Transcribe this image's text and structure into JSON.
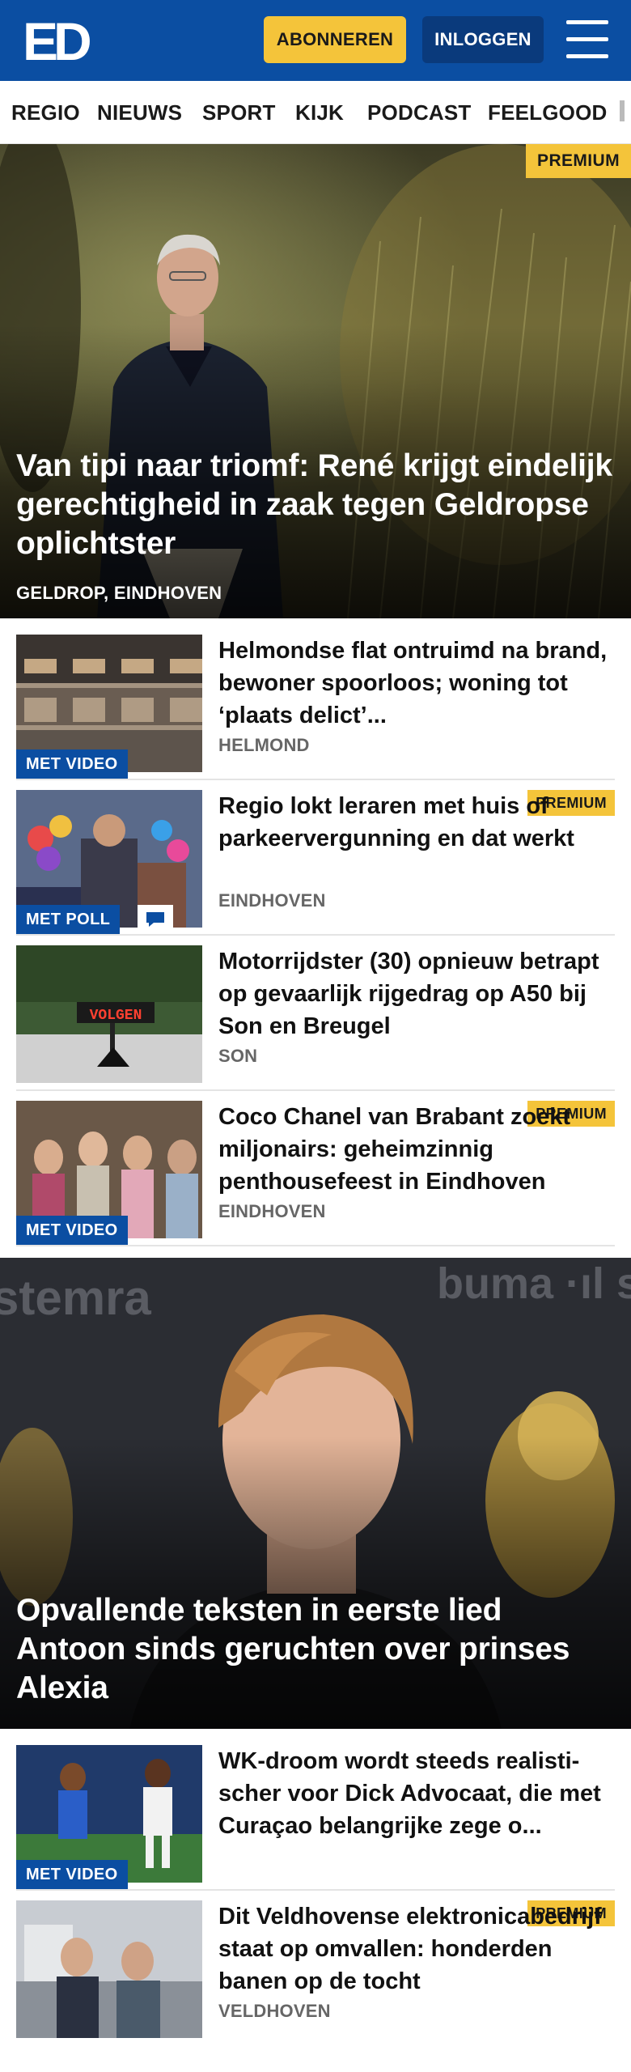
{
  "header": {
    "logo_text": "ED",
    "subscribe_label": "ABONNEREN",
    "login_label": "INLOGGEN",
    "menu_icon": "hamburger-menu-icon",
    "brand_color": "#0b4ea2",
    "accent_color": "#f4c43a"
  },
  "nav": {
    "items": [
      "REGIO",
      "NIEUWS",
      "SPORT",
      "KIJK",
      "PODCAST",
      "FEELGOOD"
    ]
  },
  "hero1": {
    "badge": "PREMIUM",
    "title": "Van tipi naar triomf: René krijgt eindelijk gerechtigheid in zaak tegen Geldropse oplichtster",
    "location": "GELDROP, EINDHOVEN"
  },
  "articles": [
    {
      "title": "Helmondse flat ontruimd na brand, bewoner spoorloos; woning tot ‘plaats delict’...",
      "location": "HELMOND",
      "badge": "MET VIDEO"
    },
    {
      "title": "Regio lokt leraren met huis of parkeervergunning en dat werkt",
      "location": "EINDHOVEN",
      "badge": "MET POLL",
      "premium": "PREMIUM",
      "icon": "comment-icon"
    },
    {
      "title": "Motorrijdster (30) opnieuw betrapt op gevaarlijk rijgedrag op A50 bij Son en Breugel",
      "location": "SON",
      "sign_text": "VOLGEN"
    },
    {
      "title": "Coco Chanel van Brabant zoekt miljonairs: geheimzinnig penthousefeest in Eindhoven",
      "location": "EINDHOVEN",
      "badge": "MET VIDEO",
      "premium": "PREMIUM"
    }
  ],
  "hero2": {
    "title": "Opvallende teksten in eerste lied Antoon sinds geruchten over prinses Alexia",
    "backdrop_text_left": "stemra",
    "backdrop_text_right": "buma ·ıl s"
  },
  "articles2": [
    {
      "title": "WK-droom wordt steeds realisti­scher voor Dick Advocaat, die met Curaçao belangrijke zege o...",
      "badge": "MET VIDEO"
    },
    {
      "title": "Dit Veldhovense elektronicabe­drijf staat op omvallen: honderden banen op de tocht",
      "location": "VELDHOVEN",
      "premium": "PREMIUM"
    }
  ]
}
